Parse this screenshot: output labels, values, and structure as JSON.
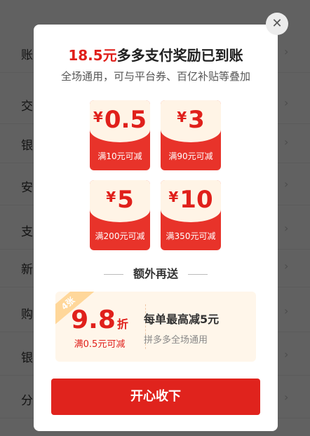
{
  "background": {
    "rows": [
      {
        "label": "账"
      },
      {
        "label": "交"
      },
      {
        "label": "银"
      },
      {
        "label": "安"
      },
      {
        "label": "支"
      },
      {
        "label": "新"
      },
      {
        "label": "购"
      },
      {
        "label": "银"
      },
      {
        "label": "分"
      }
    ],
    "chevron": "›"
  },
  "dialog": {
    "close_icon": "✕",
    "title_amount": "18.5元",
    "title_text": "多多支付奖励已到账",
    "subtitle": "全场通用，可与平台券、百亿补贴等叠加",
    "coupons": [
      {
        "currency": "¥",
        "value": "0.5",
        "condition": "满10元可减"
      },
      {
        "currency": "¥",
        "value": "3",
        "condition": "满90元可减"
      },
      {
        "currency": "¥",
        "value": "5",
        "condition": "满200元可减"
      },
      {
        "currency": "¥",
        "value": "10",
        "condition": "满350元可减"
      }
    ],
    "extra_heading": "额外再送",
    "extra_card": {
      "tag": "4张",
      "value": "9.8",
      "unit": "折",
      "condition": "满0.5元可减",
      "main_text": "每单最高减5元",
      "sub_text": "拼多多全场通用"
    },
    "accept_label": "开心收下"
  },
  "colors": {
    "accent": "#e0201b",
    "coupon_red": "#e8332a",
    "card_bg": "#fff6ea"
  }
}
